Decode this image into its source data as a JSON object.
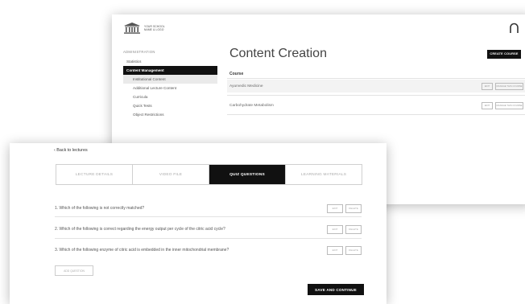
{
  "brand": {
    "line1": "YOUR SCHOOL",
    "line2": "NAME & LOGO"
  },
  "sidebar": {
    "heading": "ADMINISTRATION",
    "items": [
      {
        "label": "Statistics",
        "active": false,
        "sub": false
      },
      {
        "label": "Content Management",
        "active": true,
        "sub": false
      },
      {
        "label": "Institutional Content",
        "active": false,
        "sub": true
      },
      {
        "label": "Additional Lecture Content",
        "active": false,
        "sub": true
      },
      {
        "label": "Curricula",
        "active": false,
        "sub": true
      },
      {
        "label": "Quick Tests",
        "active": false,
        "sub": true
      },
      {
        "label": "Object Restrictions",
        "active": false,
        "sub": true
      }
    ]
  },
  "content": {
    "title": "Content Creation",
    "create_label": "CREATE COURSE",
    "column_header": "Course",
    "courses": [
      {
        "name": "Ayurvedic Medicine",
        "edit": "EDIT",
        "manage": "MANAGE THIS COURSE"
      },
      {
        "name": "Carbohydrate Metabolism",
        "edit": "EDIT",
        "manage": "MANAGE THIS COURSE"
      }
    ]
  },
  "editor": {
    "back_label": "Back to lectures",
    "tabs": [
      {
        "label": "LECTURE DETAILS",
        "active": false
      },
      {
        "label": "VIDEO FILE",
        "active": false
      },
      {
        "label": "QUIZ QUESTIONS",
        "active": true
      },
      {
        "label": "LEARNING MATERIALS",
        "active": false
      }
    ],
    "questions": [
      {
        "text": "1. Which of the following is not correctly matched?",
        "edit": "EDIT",
        "delete": "DELETE"
      },
      {
        "text": "2. Which of the following is correct regarding the energy output per cycle of the citric acid cycle?",
        "edit": "EDIT",
        "delete": "DELETE"
      },
      {
        "text": "3. Which of the following enzyme of citric acid is embedded in the inner mitochondrial membrane?",
        "edit": "EDIT",
        "delete": "DELETE"
      }
    ],
    "add_label": "ADD QUESTION",
    "save_label": "SAVE AND CONTINUE"
  }
}
